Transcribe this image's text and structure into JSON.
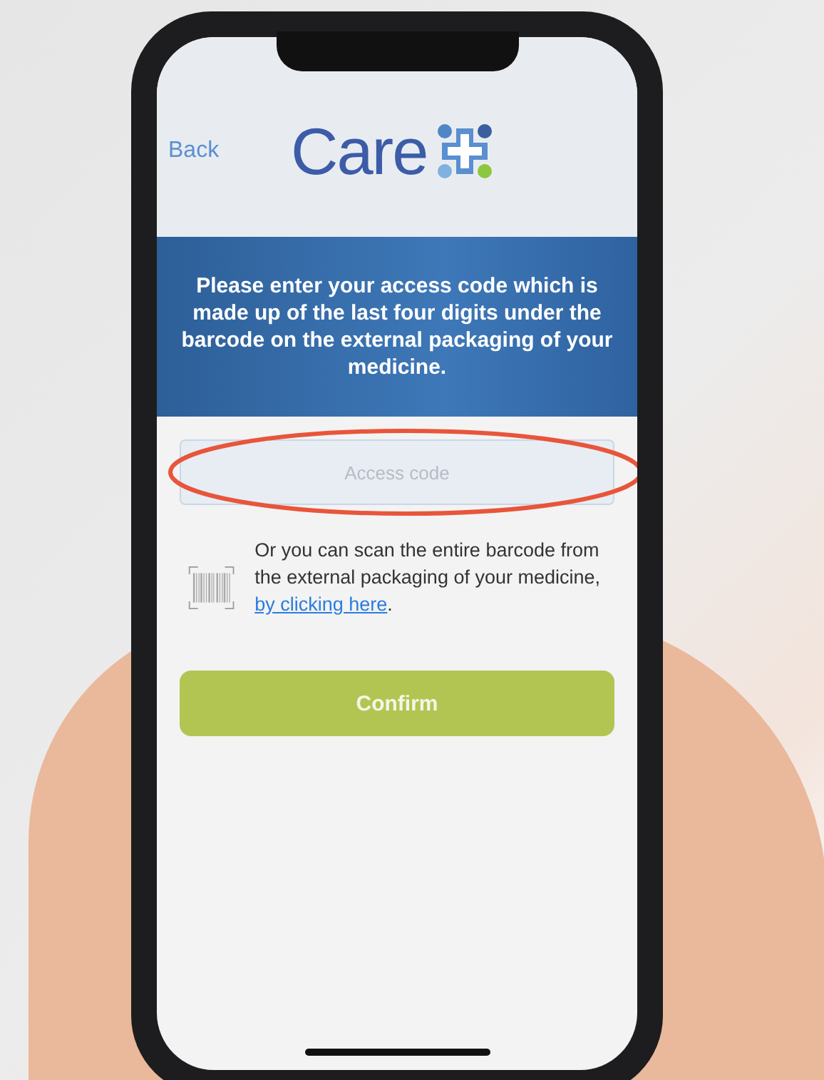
{
  "header": {
    "back": "Back",
    "logo_text": "Care"
  },
  "banner": {
    "text": "Please enter your access code which is made up of the last four digits under the barcode on the external packaging of your medicine."
  },
  "access_field": {
    "placeholder": "Access code",
    "annotation": {
      "kind": "ellipse"
    }
  },
  "scan": {
    "text": "Or you can scan the entire barcode from the external packaging of your medicine,",
    "link": "by clicking here",
    "after": "."
  },
  "confirm_button": {
    "label": "Confirm"
  }
}
